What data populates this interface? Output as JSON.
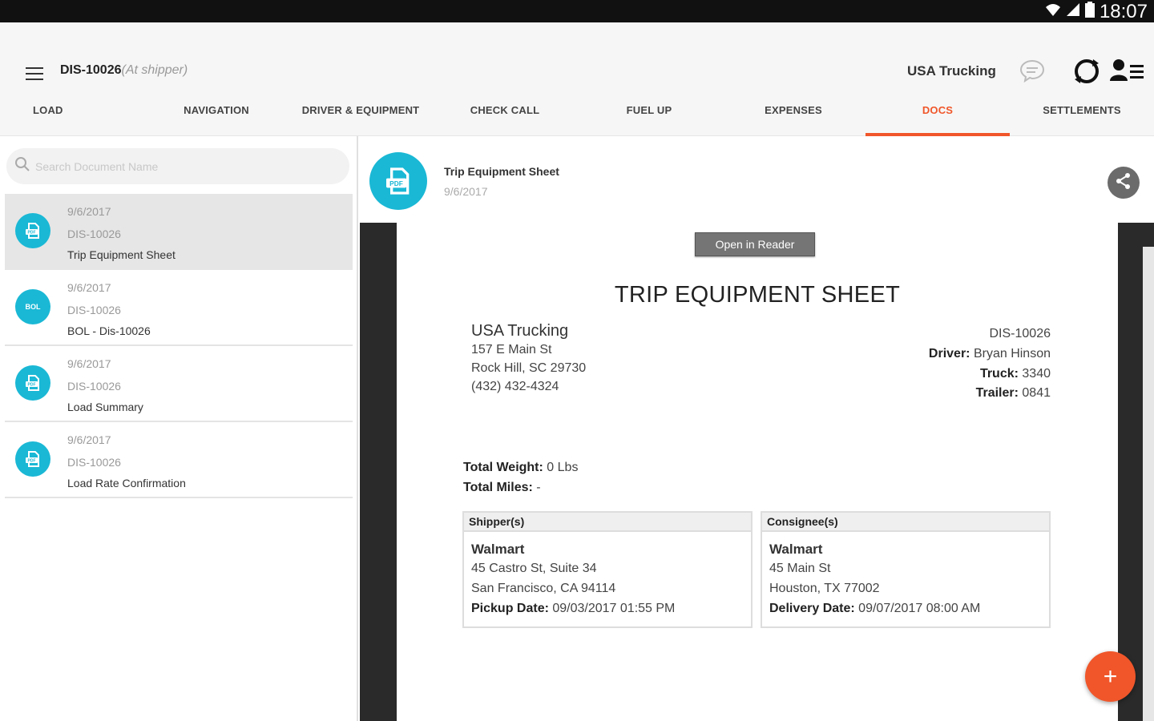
{
  "status_bar": {
    "time": "18:07"
  },
  "header": {
    "load_id": "DIS-10026",
    "load_status": "(At shipper)",
    "company": "USA Trucking"
  },
  "tabs": [
    {
      "label": "LOAD"
    },
    {
      "label": "NAVIGATION"
    },
    {
      "label": "DRIVER & EQUIPMENT"
    },
    {
      "label": "CHECK CALL"
    },
    {
      "label": "FUEL UP"
    },
    {
      "label": "EXPENSES"
    },
    {
      "label": "DOCS",
      "active": true
    },
    {
      "label": "SETTLEMENTS"
    }
  ],
  "search": {
    "placeholder": "Search Document Name"
  },
  "documents": [
    {
      "date": "9/6/2017",
      "id": "DIS-10026",
      "name": "Trip Equipment Sheet",
      "badge": "PDF",
      "selected": true
    },
    {
      "date": "9/6/2017",
      "id": "DIS-10026",
      "name": "BOL - Dis-10026",
      "badge": "BOL"
    },
    {
      "date": "9/6/2017",
      "id": "DIS-10026",
      "name": "Load Summary",
      "badge": "PDF"
    },
    {
      "date": "9/6/2017",
      "id": "DIS-10026",
      "name": "Load Rate Confirmation",
      "badge": "PDF"
    }
  ],
  "viewer": {
    "title": "Trip Equipment Sheet",
    "date": "9/6/2017",
    "open_reader": "Open in Reader",
    "sheet": {
      "heading": "TRIP EQUIPMENT SHEET",
      "company": {
        "name": "USA Trucking",
        "address1": "157 E Main St",
        "address2": "Rock Hill, SC 29730",
        "phone": "(432) 432-4324"
      },
      "load_id": "DIS-10026",
      "driver_label": "Driver:",
      "driver": "Bryan Hinson",
      "truck_label": "Truck:",
      "truck": "3340",
      "trailer_label": "Trailer:",
      "trailer": "0841",
      "total_weight_label": "Total Weight:",
      "total_weight": "0 Lbs",
      "total_miles_label": "Total Miles:",
      "total_miles": "-",
      "shipper": {
        "header": "Shipper(s)",
        "name": "Walmart",
        "address1": "45 Castro St, Suite 34",
        "address2": "San Francisco, CA 94114",
        "date_label": "Pickup Date:",
        "date": "09/03/2017 01:55 PM"
      },
      "consignee": {
        "header": "Consignee(s)",
        "name": "Walmart",
        "address1": "45 Main St",
        "address2": "Houston, TX 77002",
        "date_label": "Delivery Date:",
        "date": "09/07/2017 08:00 AM"
      }
    }
  },
  "fab": {
    "label": "+"
  },
  "colors": {
    "accent": "#f0562a",
    "badge": "#1ab8d5"
  }
}
